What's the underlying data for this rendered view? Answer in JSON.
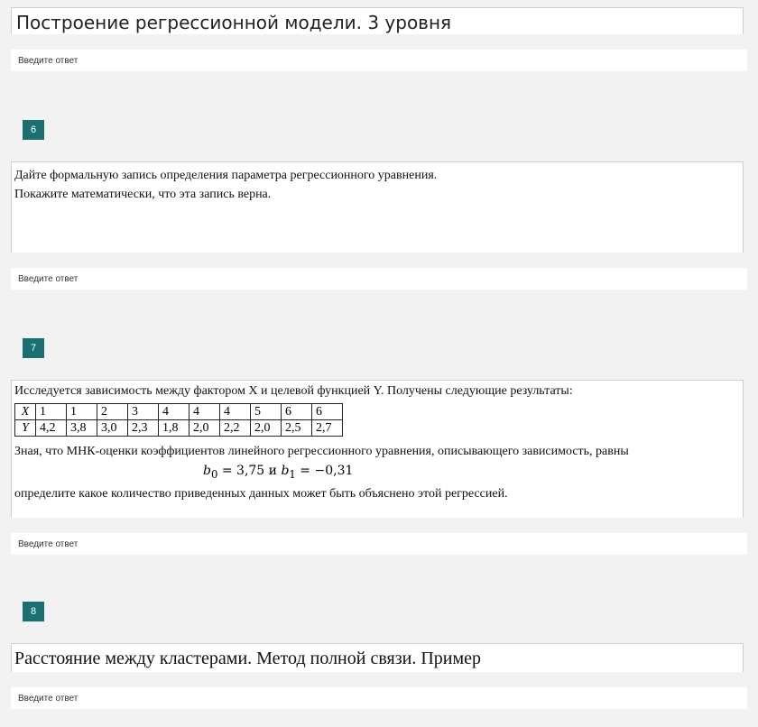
{
  "answer_placeholder": "Введите ответ",
  "q_prev": {
    "text": "Построение регрессионной модели. 3 уровня"
  },
  "q6": {
    "number": "6",
    "line1": "Дайте формальную запись определения параметра регрессионного уравнения.",
    "line2": "Покажите математически, что эта запись верна."
  },
  "q7": {
    "number": "7",
    "intro": "Исследуется зависимость между фактором X и целевой функцией Y. Получены следующие результаты:",
    "table": {
      "x_label": "X",
      "y_label": "Y",
      "x": [
        "1",
        "1",
        "2",
        "3",
        "4",
        "4",
        "4",
        "5",
        "6",
        "6"
      ],
      "y": [
        "4,2",
        "3,8",
        "3,0",
        "2,3",
        "1,8",
        "2,0",
        "2,2",
        "2,0",
        "2,5",
        "2,7"
      ]
    },
    "line2": "Зная, что МНК-оценки коэффициентов линейного регрессионного уравнения, описывающего зависимость, равны",
    "b0_value": "3,75",
    "b1_value": "−0,31",
    "conj": "и",
    "line3": "определите какое количество приведенных данных может быть объяснено этой регрессией."
  },
  "q8": {
    "number": "8",
    "text": "Расстояние между кластерами. Метод полной связи. Пример"
  }
}
